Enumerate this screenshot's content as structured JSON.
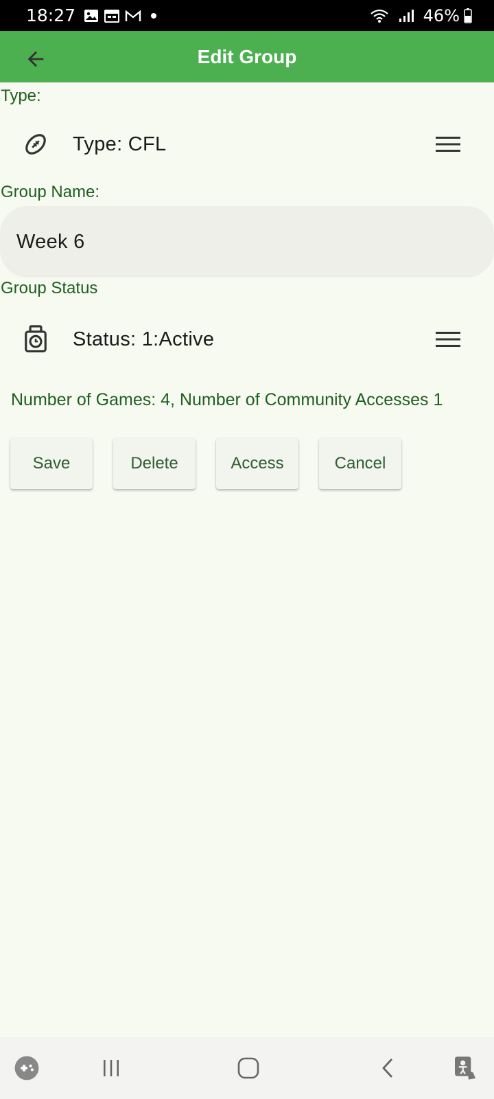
{
  "status_bar": {
    "time": "18:27",
    "battery": "46%",
    "icons": [
      "gallery-icon",
      "calendar-icon",
      "gmail-icon",
      "notification-dot",
      "wifi-icon",
      "signal-icon",
      "battery-icon"
    ]
  },
  "app_bar": {
    "title": "Edit Group",
    "back_icon": "arrow-back-icon",
    "color": "#4caf50"
  },
  "type_section": {
    "label": "Type:",
    "value": "Type: CFL",
    "icon": "football-icon",
    "menu_icon": "menu-icon"
  },
  "group_name": {
    "label": "Group Name:",
    "value": "Week 6"
  },
  "status_section": {
    "label": "Group Status",
    "value": "Status: 1:Active",
    "icon": "timer-icon",
    "menu_icon": "menu-icon"
  },
  "info": "Number of Games: 4, Number of Community Accesses 1",
  "buttons": {
    "save": "Save",
    "delete": "Delete",
    "access": "Access",
    "cancel": "Cancel"
  },
  "nav_bar": {
    "icons": [
      "game-launcher-icon",
      "recent-apps-icon",
      "home-icon",
      "back-icon",
      "accessibility-icon"
    ]
  }
}
